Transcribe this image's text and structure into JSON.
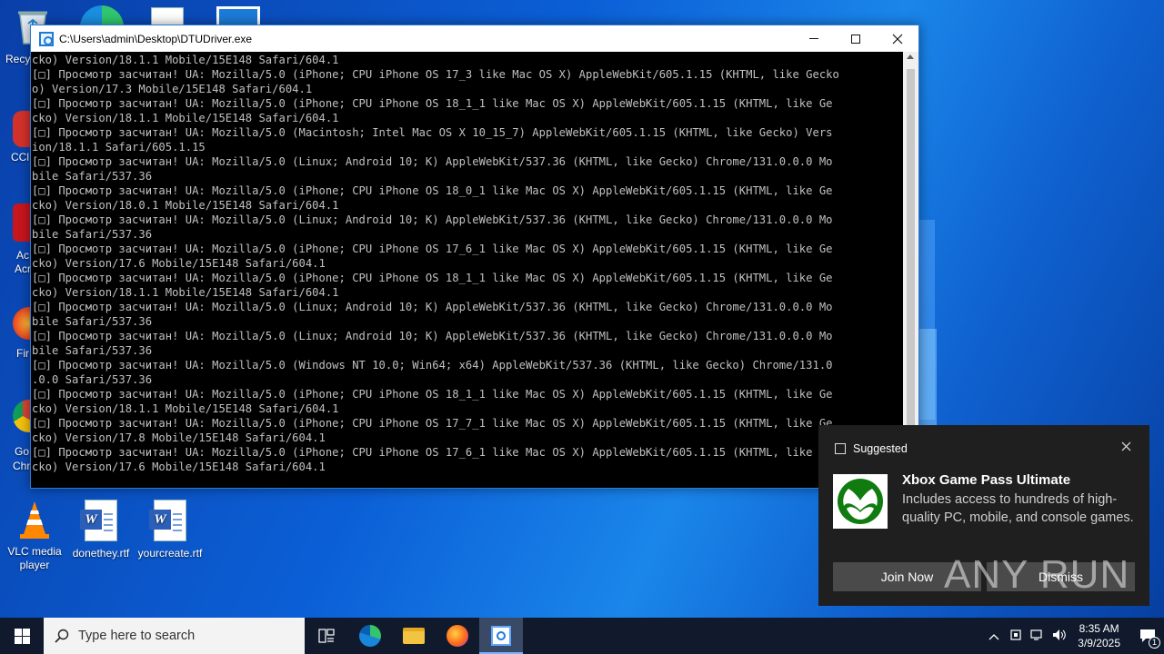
{
  "desktop": {
    "icons": [
      {
        "label": "Recycle Bin"
      },
      {
        "label": "CCleaner"
      },
      {
        "label": "Acrobat Reader"
      },
      {
        "label": "Firefox"
      },
      {
        "label": "Google Chrome"
      },
      {
        "label": "VLC media player"
      },
      {
        "label": "donethey.rtf"
      },
      {
        "label": "yourcreate.rtf"
      }
    ],
    "partial_labels": [
      "Recyc",
      "CCl",
      "Ac",
      "Acr",
      "Fir",
      "Go",
      "Chr"
    ]
  },
  "window": {
    "title": "C:\\Users\\admin\\Desktop\\DTUDriver.exe",
    "lines": [
      "cko) Version/18.1.1 Mobile/15E148 Safari/604.1",
      "[□] Просмотр засчитан! UA: Mozilla/5.0 (iPhone; CPU iPhone OS 17_3 like Mac OS X) AppleWebKit/605.1.15 (KHTML, like Gecko",
      "o) Version/17.3 Mobile/15E148 Safari/604.1",
      "[□] Просмотр засчитан! UA: Mozilla/5.0 (iPhone; CPU iPhone OS 18_1_1 like Mac OS X) AppleWebKit/605.1.15 (KHTML, like Ge",
      "cko) Version/18.1.1 Mobile/15E148 Safari/604.1",
      "[□] Просмотр засчитан! UA: Mozilla/5.0 (Macintosh; Intel Mac OS X 10_15_7) AppleWebKit/605.1.15 (KHTML, like Gecko) Vers",
      "ion/18.1.1 Safari/605.1.15",
      "[□] Просмотр засчитан! UA: Mozilla/5.0 (Linux; Android 10; K) AppleWebKit/537.36 (KHTML, like Gecko) Chrome/131.0.0.0 Mo",
      "bile Safari/537.36",
      "[□] Просмотр засчитан! UA: Mozilla/5.0 (iPhone; CPU iPhone OS 18_0_1 like Mac OS X) AppleWebKit/605.1.15 (KHTML, like Ge",
      "cko) Version/18.0.1 Mobile/15E148 Safari/604.1",
      "[□] Просмотр засчитан! UA: Mozilla/5.0 (Linux; Android 10; K) AppleWebKit/537.36 (KHTML, like Gecko) Chrome/131.0.0.0 Mo",
      "bile Safari/537.36",
      "[□] Просмотр засчитан! UA: Mozilla/5.0 (iPhone; CPU iPhone OS 17_6_1 like Mac OS X) AppleWebKit/605.1.15 (KHTML, like Ge",
      "cko) Version/17.6 Mobile/15E148 Safari/604.1",
      "[□] Просмотр засчитан! UA: Mozilla/5.0 (iPhone; CPU iPhone OS 18_1_1 like Mac OS X) AppleWebKit/605.1.15 (KHTML, like Ge",
      "cko) Version/18.1.1 Mobile/15E148 Safari/604.1",
      "[□] Просмотр засчитан! UA: Mozilla/5.0 (Linux; Android 10; K) AppleWebKit/537.36 (KHTML, like Gecko) Chrome/131.0.0.0 Mo",
      "bile Safari/537.36",
      "[□] Просмотр засчитан! UA: Mozilla/5.0 (Linux; Android 10; K) AppleWebKit/537.36 (KHTML, like Gecko) Chrome/131.0.0.0 Mo",
      "bile Safari/537.36",
      "[□] Просмотр засчитан! UA: Mozilla/5.0 (Windows NT 10.0; Win64; x64) AppleWebKit/537.36 (KHTML, like Gecko) Chrome/131.0",
      ".0.0 Safari/537.36",
      "[□] Просмотр засчитан! UA: Mozilla/5.0 (iPhone; CPU iPhone OS 18_1_1 like Mac OS X) AppleWebKit/605.1.15 (KHTML, like Ge",
      "cko) Version/18.1.1 Mobile/15E148 Safari/604.1",
      "[□] Просмотр засчитан! UA: Mozilla/5.0 (iPhone; CPU iPhone OS 17_7_1 like Mac OS X) AppleWebKit/605.1.15 (KHTML, like Ge",
      "cko) Version/17.8 Mobile/15E148 Safari/604.1",
      "[□] Просмотр засчитан! UA: Mozilla/5.0 (iPhone; CPU iPhone OS 17_6_1 like Mac OS X) AppleWebKit/605.1.15 (KHTML, like Ge",
      "cko) Version/17.6 Mobile/15E148 Safari/604.1"
    ]
  },
  "toast": {
    "header": "Suggested",
    "title": "Xbox Game Pass Ultimate",
    "body": "Includes access to hundreds of high-quality PC, mobile, and console games.",
    "join_label": "Join Now",
    "dismiss_label": "Dismiss",
    "watermark": "ANY RUN"
  },
  "taskbar": {
    "search_placeholder": "Type here to search",
    "time": "8:35 AM",
    "date": "3/9/2025",
    "notification_count": "1"
  },
  "colors": {
    "console_text": "#c0c0c0",
    "console_bg": "#000000",
    "toast_bg": "#1f1f1f",
    "xbox_green": "#107c10"
  }
}
